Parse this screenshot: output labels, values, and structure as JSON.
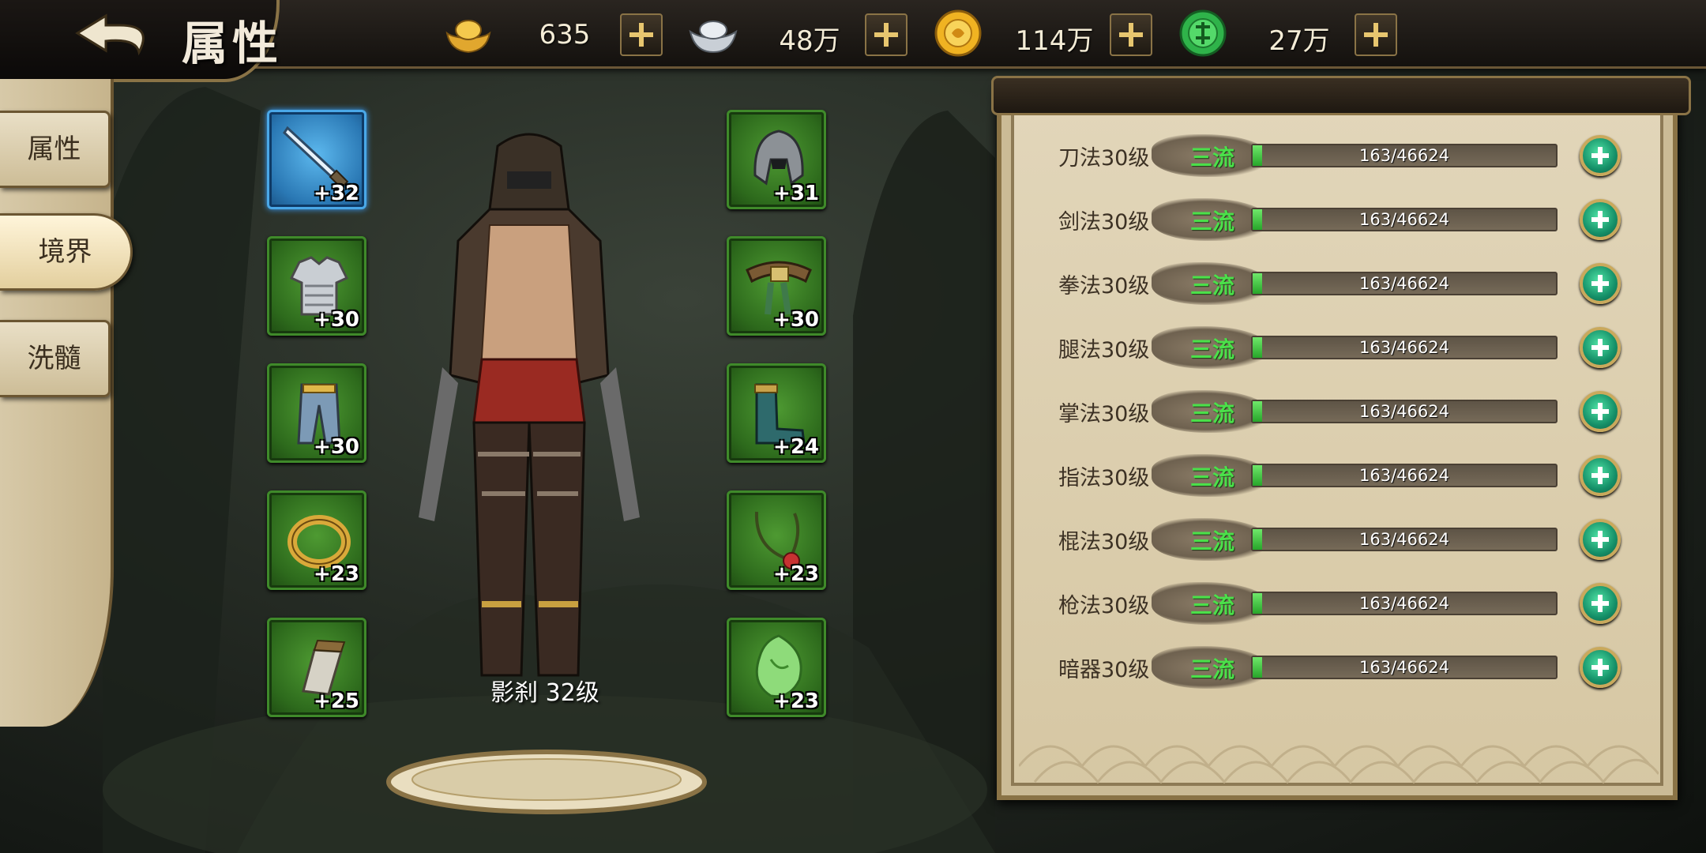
{
  "header": {
    "title": "属性",
    "currencies": [
      {
        "icon": "gold-ingot-icon",
        "amount": "635"
      },
      {
        "icon": "silver-ingot-icon",
        "amount": "48万"
      },
      {
        "icon": "gold-coin-icon",
        "amount": "114万"
      },
      {
        "icon": "jade-token-icon",
        "amount": "27万"
      }
    ]
  },
  "sidebar": {
    "tabs": [
      {
        "label": "属性",
        "active": false
      },
      {
        "label": "境界",
        "active": true
      },
      {
        "label": "洗髓",
        "active": false
      }
    ]
  },
  "equipment": {
    "left": [
      {
        "name": "sword-icon",
        "bonus": "+32",
        "rarity": "blue"
      },
      {
        "name": "armor-icon",
        "bonus": "+30",
        "rarity": "green"
      },
      {
        "name": "leggings-icon",
        "bonus": "+30",
        "rarity": "green"
      },
      {
        "name": "ring-icon",
        "bonus": "+23",
        "rarity": "green"
      },
      {
        "name": "bracer-icon",
        "bonus": "+25",
        "rarity": "green"
      }
    ],
    "right": [
      {
        "name": "helmet-icon",
        "bonus": "+31",
        "rarity": "green"
      },
      {
        "name": "belt-icon",
        "bonus": "+30",
        "rarity": "green"
      },
      {
        "name": "boots-icon",
        "bonus": "+24",
        "rarity": "green"
      },
      {
        "name": "necklace-icon",
        "bonus": "+23",
        "rarity": "green"
      },
      {
        "name": "jade-pendant-icon",
        "bonus": "+23",
        "rarity": "green"
      }
    ]
  },
  "character": {
    "label": "影刹  32级"
  },
  "skills": [
    {
      "name": "刀法30级",
      "rank": "三流",
      "progress": "163/46624",
      "ratio": 0.0035
    },
    {
      "name": "剑法30级",
      "rank": "三流",
      "progress": "163/46624",
      "ratio": 0.0035
    },
    {
      "name": "拳法30级",
      "rank": "三流",
      "progress": "163/46624",
      "ratio": 0.0035
    },
    {
      "name": "腿法30级",
      "rank": "三流",
      "progress": "163/46624",
      "ratio": 0.0035
    },
    {
      "name": "掌法30级",
      "rank": "三流",
      "progress": "163/46624",
      "ratio": 0.0035
    },
    {
      "name": "指法30级",
      "rank": "三流",
      "progress": "163/46624",
      "ratio": 0.0035
    },
    {
      "name": "棍法30级",
      "rank": "三流",
      "progress": "163/46624",
      "ratio": 0.0035
    },
    {
      "name": "枪法30级",
      "rank": "三流",
      "progress": "163/46624",
      "ratio": 0.0035
    },
    {
      "name": "暗器30级",
      "rank": "三流",
      "progress": "163/46624",
      "ratio": 0.0035
    }
  ],
  "colors": {
    "rank_text": "#4be04a",
    "slot_green": "#3f8a2a",
    "slot_blue": "#4aa8e8",
    "frame_gold": "#8a7346"
  }
}
